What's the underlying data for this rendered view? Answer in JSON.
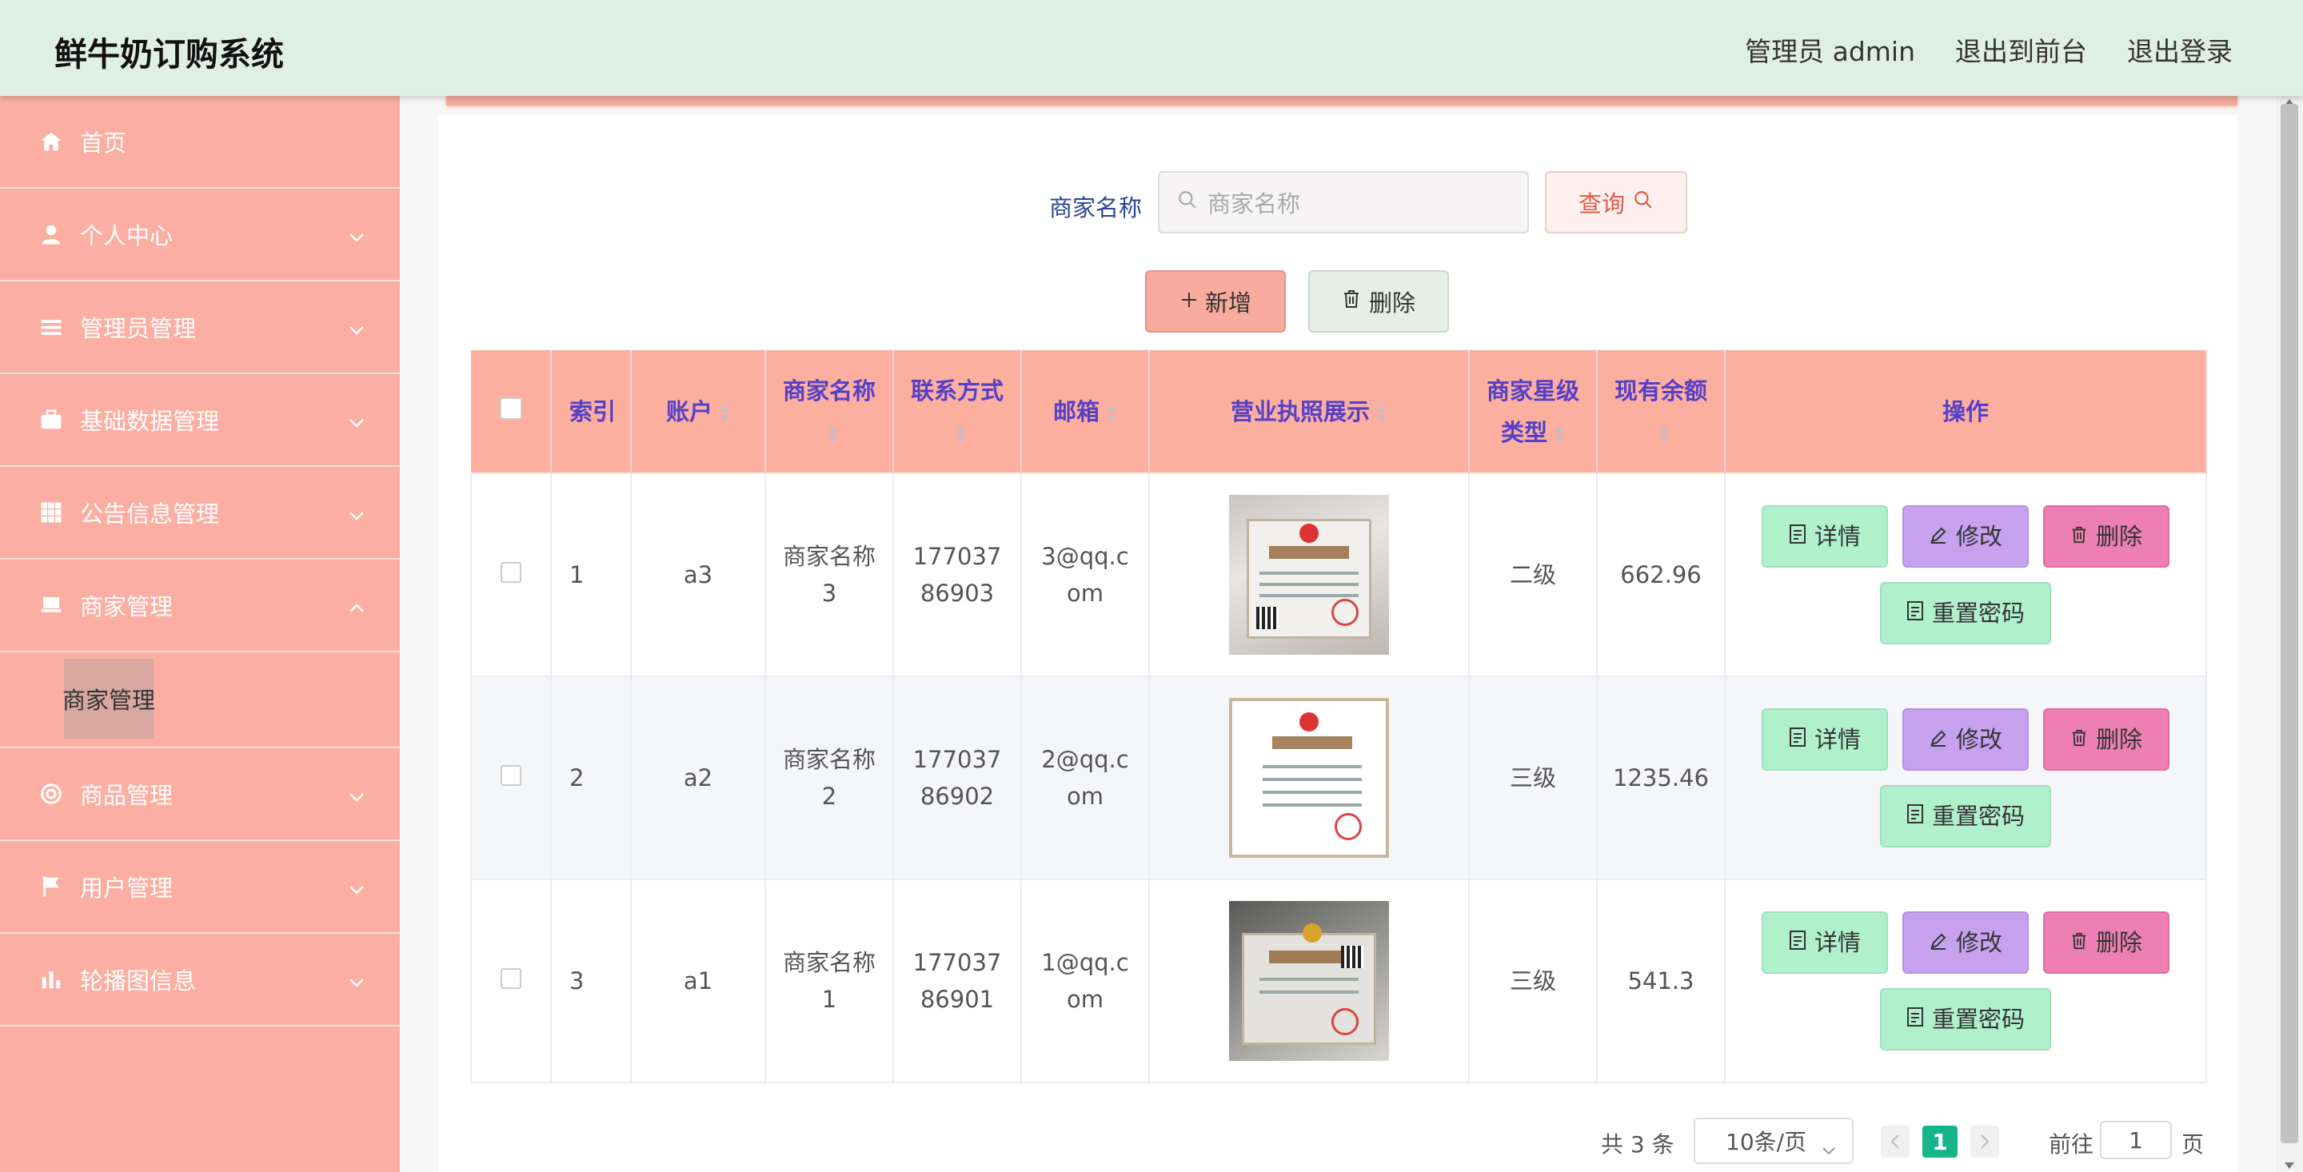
{
  "header": {
    "title": "鲜牛奶订购系统",
    "admin_label": "管理员 admin",
    "to_front": "退出到前台",
    "logout": "退出登录"
  },
  "sidebar": {
    "items": [
      {
        "label": "首页",
        "icon": "home-icon"
      },
      {
        "label": "个人中心",
        "icon": "user-icon"
      },
      {
        "label": "管理员管理",
        "icon": "list-icon"
      },
      {
        "label": "基础数据管理",
        "icon": "briefcase-icon"
      },
      {
        "label": "公告信息管理",
        "icon": "grid-icon"
      },
      {
        "label": "商家管理",
        "icon": "laptop-icon"
      },
      {
        "label": "商品管理",
        "icon": "lifebuoy-icon"
      },
      {
        "label": "用户管理",
        "icon": "flag-icon"
      },
      {
        "label": "轮播图信息",
        "icon": "bar-chart-icon"
      }
    ],
    "sub_item": "商家管理"
  },
  "search": {
    "label": "商家名称",
    "placeholder": "商家名称",
    "button": "查询"
  },
  "toolbar": {
    "add": "新增",
    "delete": "删除"
  },
  "table": {
    "headers": {
      "index": "索引",
      "account": "账户",
      "name": "商家名称",
      "phone": "联系方式",
      "email": "邮箱",
      "license": "营业执照展示",
      "level": "商家星级类型",
      "balance": "现有余额",
      "action": "操作"
    },
    "rows": [
      {
        "index": "1",
        "account": "a3",
        "name": "商家名称3",
        "phone": "17703786903",
        "email": "3@qq.com",
        "level": "二级",
        "balance": "662.96"
      },
      {
        "index": "2",
        "account": "a2",
        "name": "商家名称2",
        "phone": "17703786902",
        "email": "2@qq.com",
        "level": "三级",
        "balance": "1235.46"
      },
      {
        "index": "3",
        "account": "a1",
        "name": "商家名称1",
        "phone": "17703786901",
        "email": "1@qq.com",
        "level": "三级",
        "balance": "541.3"
      }
    ],
    "actions": {
      "detail": "详情",
      "edit": "修改",
      "delete": "删除",
      "reset": "重置密码"
    }
  },
  "pagination": {
    "total": "共 3 条",
    "page_size": "10条/页",
    "current_page": "1",
    "goto_label": "前往",
    "goto_value": "1",
    "page_suffix": "页"
  }
}
